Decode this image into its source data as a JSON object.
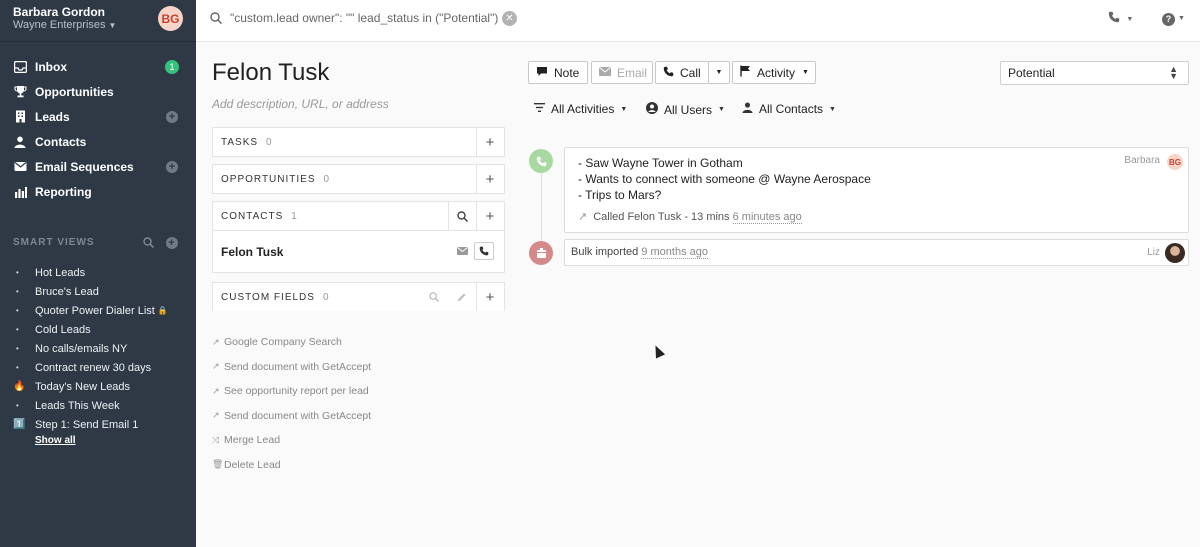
{
  "user": {
    "name": "Barbara Gordon",
    "org": "Wayne Enterprises",
    "initials": "BG"
  },
  "nav": {
    "inbox": {
      "label": "Inbox",
      "badge": "1"
    },
    "opportunities": {
      "label": "Opportunities"
    },
    "leads": {
      "label": "Leads"
    },
    "contacts": {
      "label": "Contacts"
    },
    "sequences": {
      "label": "Email Sequences"
    },
    "reporting": {
      "label": "Reporting"
    }
  },
  "smart_views": {
    "header": "SMART VIEWS",
    "items": [
      {
        "label": "Hot Leads",
        "marker": "•"
      },
      {
        "label": "Bruce's Lead",
        "marker": "•"
      },
      {
        "label": "Quoter Power Dialer List",
        "marker": "•",
        "lock": true
      },
      {
        "label": "Cold Leads",
        "marker": "•"
      },
      {
        "label": "No calls/emails NY",
        "marker": "•"
      },
      {
        "label": "Contract renew 30 days",
        "marker": "•"
      },
      {
        "label": "Today's New Leads",
        "marker": "🔥"
      },
      {
        "label": "Leads This Week",
        "marker": "•"
      },
      {
        "label": "Step 1: Send Email 1",
        "marker": "1️⃣"
      }
    ],
    "show_all": "Show all"
  },
  "search": {
    "query": "\"custom.lead owner\": \"\" lead_status in (\"Potential\")"
  },
  "lead": {
    "name": "Felon Tusk",
    "description_placeholder": "Add description, URL, or address",
    "status": "Potential"
  },
  "panels": {
    "tasks": {
      "label": "TASKS",
      "count": "0"
    },
    "opportunities": {
      "label": "OPPORTUNITIES",
      "count": "0"
    },
    "contacts": {
      "label": "CONTACTS",
      "count": "1",
      "contact_name": "Felon Tusk"
    },
    "custom_fields": {
      "label": "CUSTOM FIELDS",
      "count": "0"
    }
  },
  "links": [
    {
      "label": "Google Company Search",
      "icon": "external-link-icon"
    },
    {
      "label": "Send document with GetAccept",
      "icon": "external-link-icon"
    },
    {
      "label": "See opportunity report per lead",
      "icon": "external-link-icon"
    },
    {
      "label": "Send document with GetAccept",
      "icon": "external-link-icon"
    },
    {
      "label": "Merge Lead",
      "icon": "merge-icon"
    },
    {
      "label": "Delete Lead",
      "icon": "trash-icon"
    }
  ],
  "toolbar": {
    "note": "Note",
    "email": "Email",
    "call": "Call",
    "activity": "Activity"
  },
  "filters": {
    "activities": "All Activities",
    "users": "All Users",
    "contacts": "All Contacts"
  },
  "feed": {
    "call": {
      "lines": [
        "- Saw Wayne Tower in Gotham",
        "- Wants to connect with someone @ Wayne Aerospace",
        "- Trips to Mars?"
      ],
      "summary": "Called Felon Tusk - 13 mins",
      "ago": "6 minutes ago",
      "author": "Barbara",
      "author_initials": "BG",
      "icon_color": "#a7d9a0"
    },
    "import": {
      "text": "Bulk imported",
      "ago": "9 months ago",
      "author": "Liz",
      "icon_color": "#d48a8a"
    }
  },
  "colors": {
    "sidebar": "#2e3945",
    "badge": "#34c17b"
  }
}
